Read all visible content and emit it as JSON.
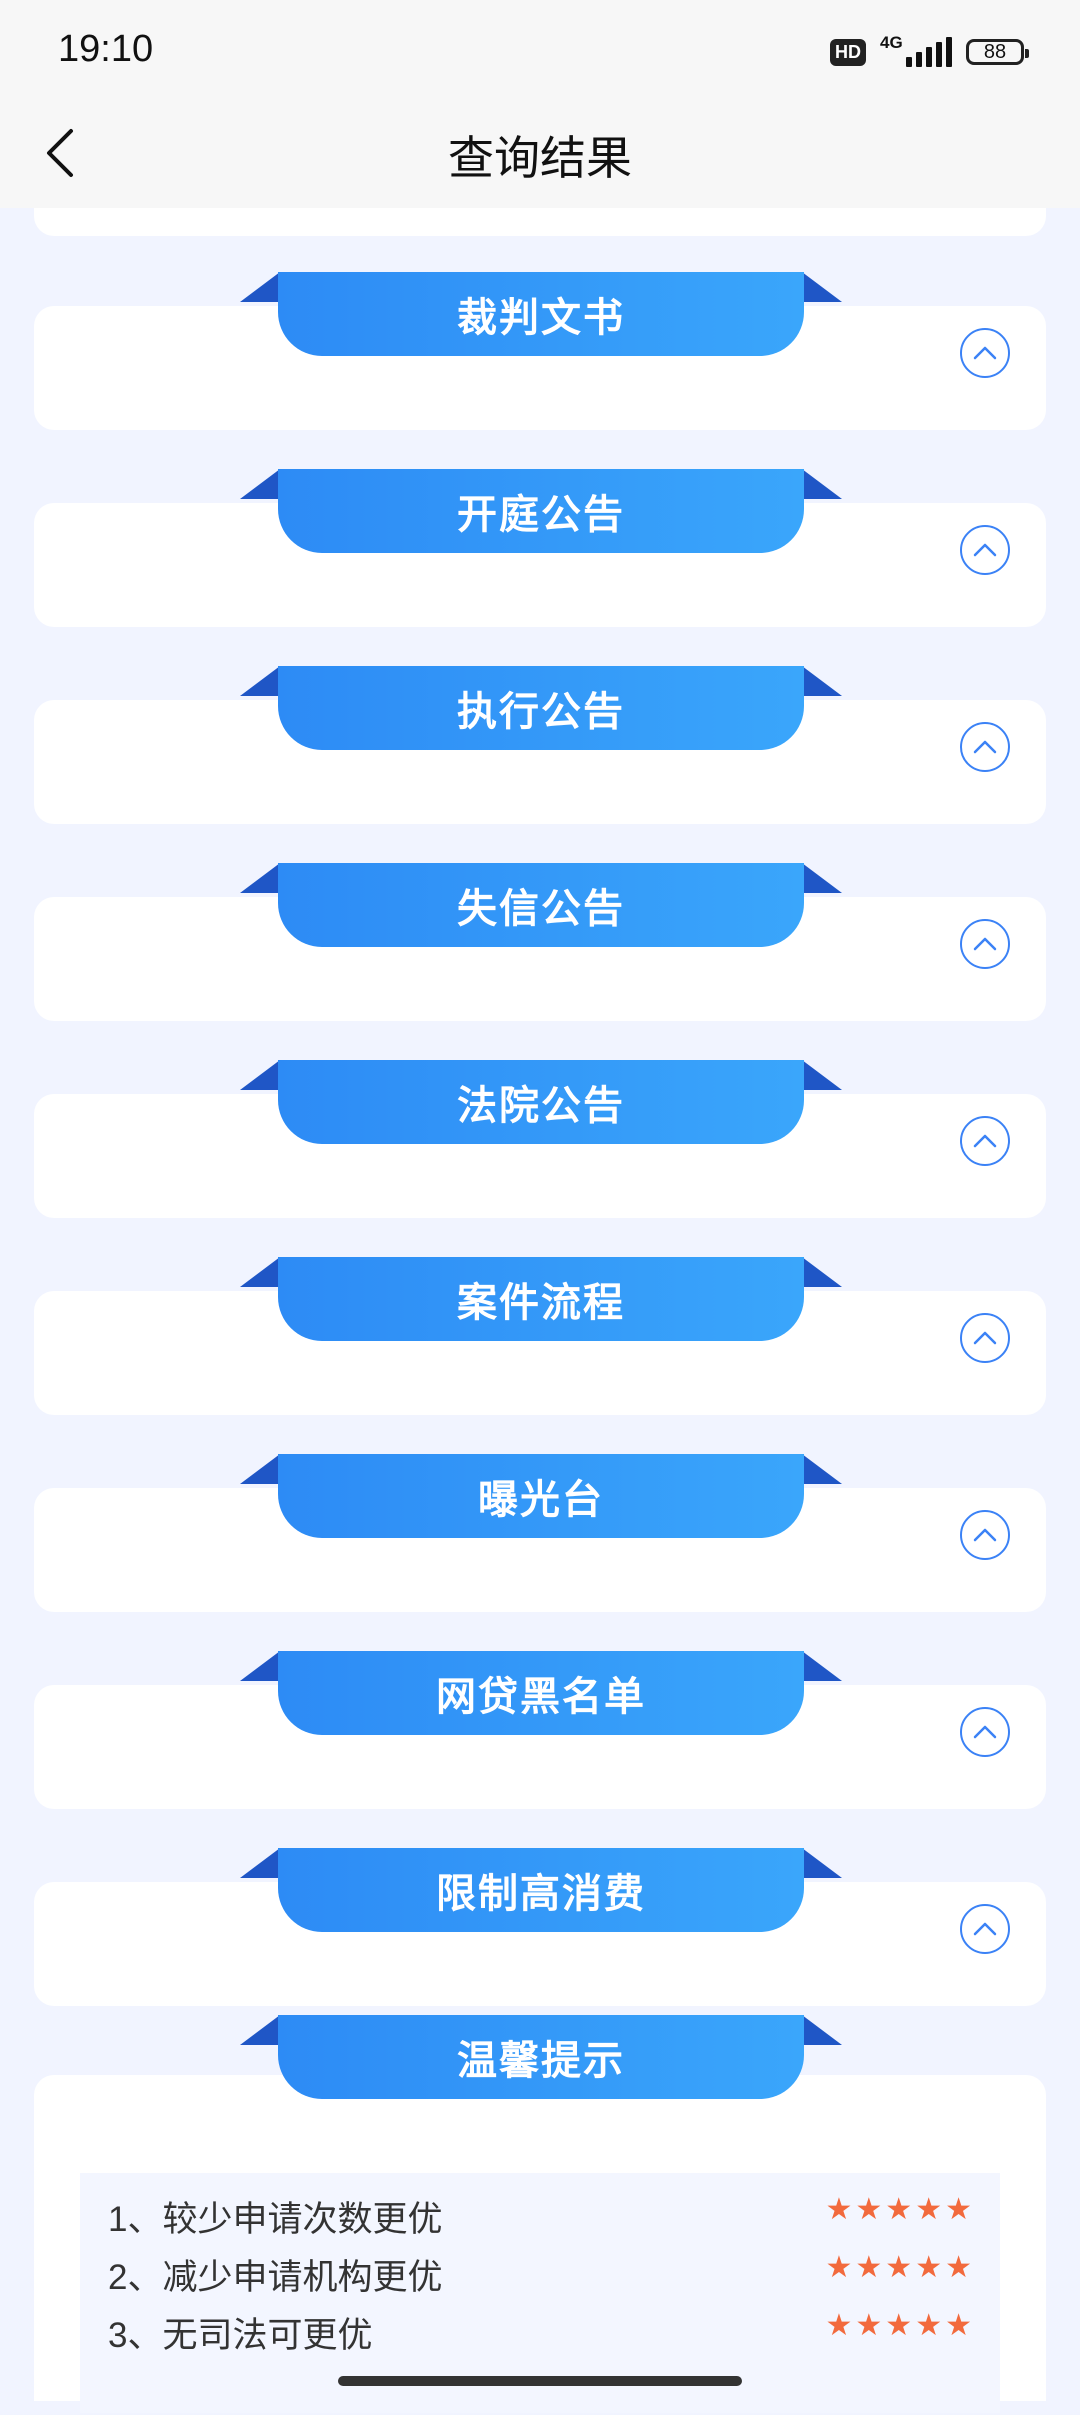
{
  "status": {
    "time": "19:10",
    "hd": "HD",
    "net": "4G",
    "battery": "88"
  },
  "nav": {
    "title": "查询结果"
  },
  "sections": [
    {
      "title": "裁判文书"
    },
    {
      "title": "开庭公告"
    },
    {
      "title": "执行公告"
    },
    {
      "title": "失信公告"
    },
    {
      "title": "法院公告"
    },
    {
      "title": "案件流程"
    },
    {
      "title": "曝光台"
    },
    {
      "title": "网贷黑名单"
    },
    {
      "title": "限制高消费"
    }
  ],
  "tips": {
    "title": "温馨提示",
    "items": [
      {
        "text": "1、较少申请次数更优",
        "stars": 5
      },
      {
        "text": "2、减少申请机构更优",
        "stars": 5
      },
      {
        "text": "3、无司法可更优",
        "stars": 5
      }
    ]
  },
  "colors": {
    "accent": "#2d8bf5",
    "star": "#f26a3d",
    "background": "#f1f4ff"
  }
}
